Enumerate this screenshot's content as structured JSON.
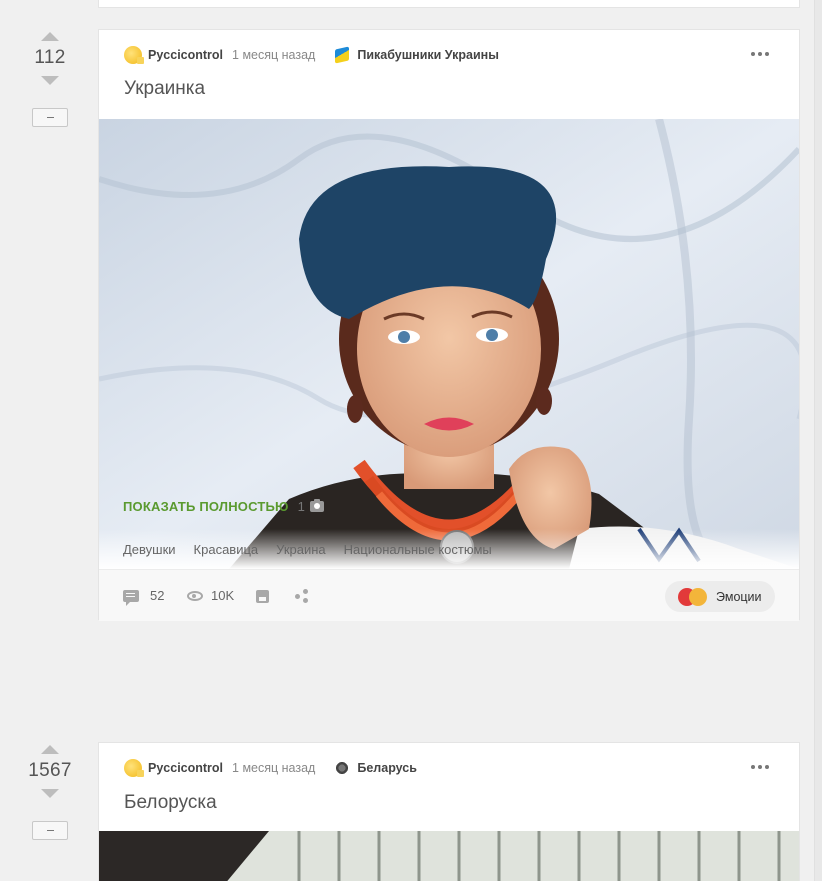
{
  "posts": [
    {
      "score": "112",
      "author": "Pyccicontrol",
      "time": "1 месяц назад",
      "community": "Пикабушники Украины",
      "title": "Украинка",
      "show_full": "ПОКАЗАТЬ ПОЛНОСТЬЮ",
      "image_count": "1",
      "tags": [
        "Девушки",
        "Красавица",
        "Украина",
        "Национальные костюмы"
      ],
      "comments": "52",
      "views": "10K",
      "emotions_label": "Эмоции"
    },
    {
      "score": "1567",
      "author": "Pyccicontrol",
      "time": "1 месяц назад",
      "community": "Беларусь",
      "title": "Белоруска"
    }
  ],
  "colors": {
    "show_full": "#5a9a2f",
    "page_bg": "#f0f0f0"
  },
  "icons": [
    "arrow-up-icon",
    "arrow-down-icon",
    "minus-icon",
    "more-icon",
    "camera-icon",
    "comment-icon",
    "eye-icon",
    "save-icon",
    "share-icon",
    "emotion-icon"
  ]
}
